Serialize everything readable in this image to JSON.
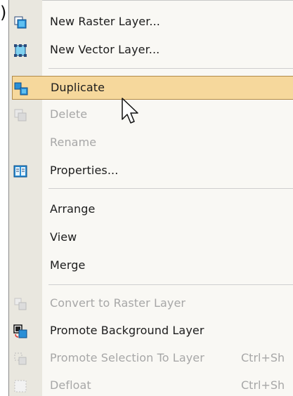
{
  "stray_char": ")",
  "menu": {
    "items": [
      {
        "label": "New Raster Layer...",
        "icon": "new-raster-layer-icon",
        "enabled": true
      },
      {
        "label": "New Vector Layer...",
        "icon": "new-vector-layer-icon",
        "enabled": true
      },
      {
        "label": "Duplicate",
        "icon": "duplicate-layer-icon",
        "enabled": true,
        "highlighted": true
      },
      {
        "label": "Delete",
        "icon": "delete-layer-icon",
        "enabled": false
      },
      {
        "label": "Rename",
        "icon": "",
        "enabled": false
      },
      {
        "label": "Properties...",
        "icon": "layer-properties-icon",
        "enabled": true
      },
      {
        "label": "Arrange",
        "icon": "",
        "enabled": true
      },
      {
        "label": "View",
        "icon": "",
        "enabled": true
      },
      {
        "label": "Merge",
        "icon": "",
        "enabled": true
      },
      {
        "label": "Convert to Raster Layer",
        "icon": "convert-to-raster-icon",
        "enabled": false
      },
      {
        "label": "Promote Background Layer",
        "icon": "promote-background-icon",
        "enabled": true
      },
      {
        "label": "Promote Selection To Layer",
        "icon": "promote-selection-icon",
        "enabled": false,
        "shortcut": "Ctrl+Sh"
      },
      {
        "label": "Defloat",
        "icon": "defloat-icon",
        "enabled": false,
        "shortcut": "Ctrl+Sh"
      }
    ]
  },
  "colors": {
    "highlight": "#f6d89c",
    "highlight_border": "#b08a4a",
    "gutter": "#e9e7df",
    "menu_bg": "#f9f8f4",
    "disabled_text": "#a7a7a7",
    "icon_blue": "#1a7fc4"
  },
  "cursor": "arrow-pointer-icon"
}
